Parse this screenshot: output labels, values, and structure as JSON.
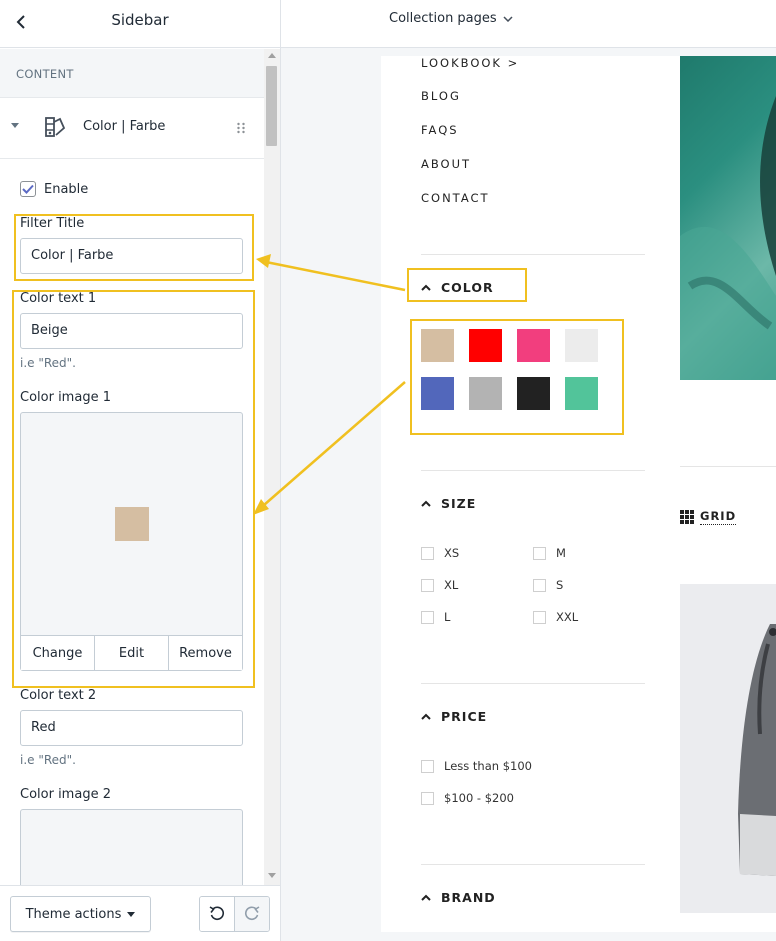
{
  "sidebar": {
    "title": "Sidebar",
    "section_label": "CONTENT",
    "block": {
      "name": "Color | Farbe"
    },
    "enable": {
      "label": "Enable",
      "checked": true
    },
    "filter_title": {
      "label": "Filter Title",
      "value": "Color | Farbe"
    },
    "color_text_1": {
      "label": "Color text 1",
      "value": "Beige",
      "help": "i.e \"Red\"."
    },
    "color_image_1": {
      "label": "Color image 1",
      "swatch_color": "#d5bea2",
      "buttons": [
        "Change",
        "Edit",
        "Remove"
      ]
    },
    "color_text_2": {
      "label": "Color text 2",
      "value": "Red",
      "help": "i.e \"Red\"."
    },
    "color_image_2": {
      "label": "Color image 2"
    },
    "footer": {
      "theme_actions_label": "Theme actions"
    }
  },
  "topbar": {
    "page_select": "Collection pages"
  },
  "preview": {
    "nav_links": [
      "LOOKBOOK >",
      "BLOG",
      "FAQS",
      "ABOUT",
      "CONTACT"
    ],
    "color_filter": {
      "title": "COLOR",
      "swatches": [
        "#d5bea2",
        "#ff0000",
        "#f23e7e",
        "#ececec",
        "#5267bb",
        "#b3b3b3",
        "#222222",
        "#52c49a"
      ]
    },
    "size_filter": {
      "title": "SIZE",
      "options": [
        "XS",
        "M",
        "XL",
        "S",
        "L",
        "XXL"
      ]
    },
    "price_filter": {
      "title": "PRICE",
      "options": [
        "Less than $100",
        "$100 - $200"
      ]
    },
    "brand_filter": {
      "title": "BRAND"
    },
    "grid_label": "GRID"
  },
  "colors": {
    "highlight": "#f0c020",
    "accent": "#5c6ac4"
  }
}
